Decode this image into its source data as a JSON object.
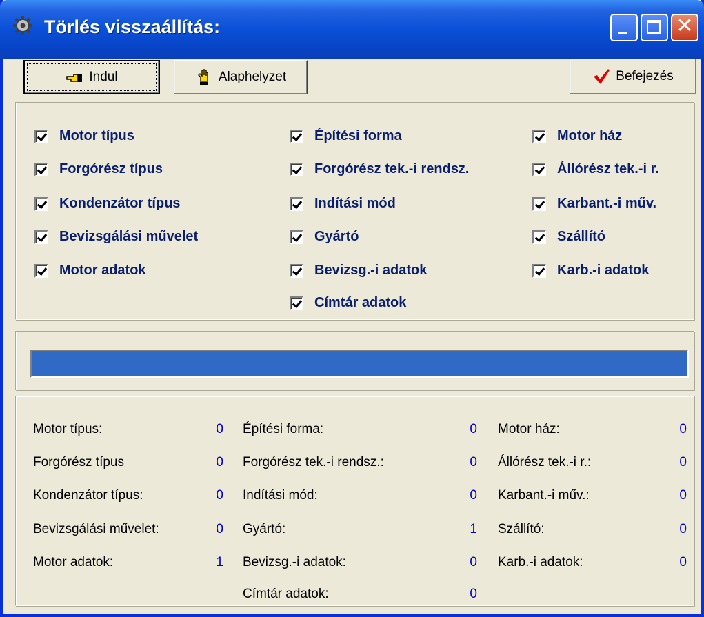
{
  "window": {
    "title": "Törlés visszaállítás:",
    "close_glyph": "✕"
  },
  "toolbar": {
    "indul_label": "Indul",
    "indul_icon": "pointing-hand-icon",
    "alaphelyzet_label": "Alaphelyzet",
    "alaphelyzet_icon": "raised-hand-icon",
    "befejezes_label": "Befejezés",
    "befejezes_icon": "red-checkmark-icon"
  },
  "checkboxes": {
    "col1": [
      "Motor típus",
      "Forgórész típus",
      "Kondenzátor típus",
      "Bevizsgálási művelet",
      "Motor adatok"
    ],
    "col2": [
      "Építési forma",
      "Forgórész tek.-i rendsz.",
      "Indítási mód",
      "Gyártó",
      "Bevizsg.-i adatok",
      "Címtár adatok"
    ],
    "col3": [
      "Motor ház",
      "Állórész tek.-i r.",
      "Karbant.-i műv.",
      "Szállító",
      "Karb.-i adatok"
    ],
    "all_checked": true
  },
  "progress": {
    "value_fraction": 1.0,
    "color": "#316ac5"
  },
  "stats": {
    "col1": [
      {
        "label": "Motor típus:",
        "value": "0"
      },
      {
        "label": "Forgórész típus",
        "value": "0"
      },
      {
        "label": "Kondenzátor típus:",
        "value": "0"
      },
      {
        "label": "Bevizsgálási művelet:",
        "value": "0"
      },
      {
        "label": "Motor adatok:",
        "value": "1"
      }
    ],
    "col2": [
      {
        "label": "Építési forma:",
        "value": "0"
      },
      {
        "label": "Forgórész tek.-i rendsz.:",
        "value": "0"
      },
      {
        "label": "Indítási mód:",
        "value": "0"
      },
      {
        "label": "Gyártó:",
        "value": "1"
      },
      {
        "label": "Bevizsg.-i adatok:",
        "value": "0"
      },
      {
        "label": "Címtár adatok:",
        "value": "0"
      }
    ],
    "col3": [
      {
        "label": "Motor ház:",
        "value": "0"
      },
      {
        "label": "Állórész tek.-i r.:",
        "value": "0"
      },
      {
        "label": "Karbant.-i műv.:",
        "value": "0"
      },
      {
        "label": "Szállító:",
        "value": "0"
      },
      {
        "label": "Karb.-i adatok:",
        "value": "0"
      }
    ]
  }
}
